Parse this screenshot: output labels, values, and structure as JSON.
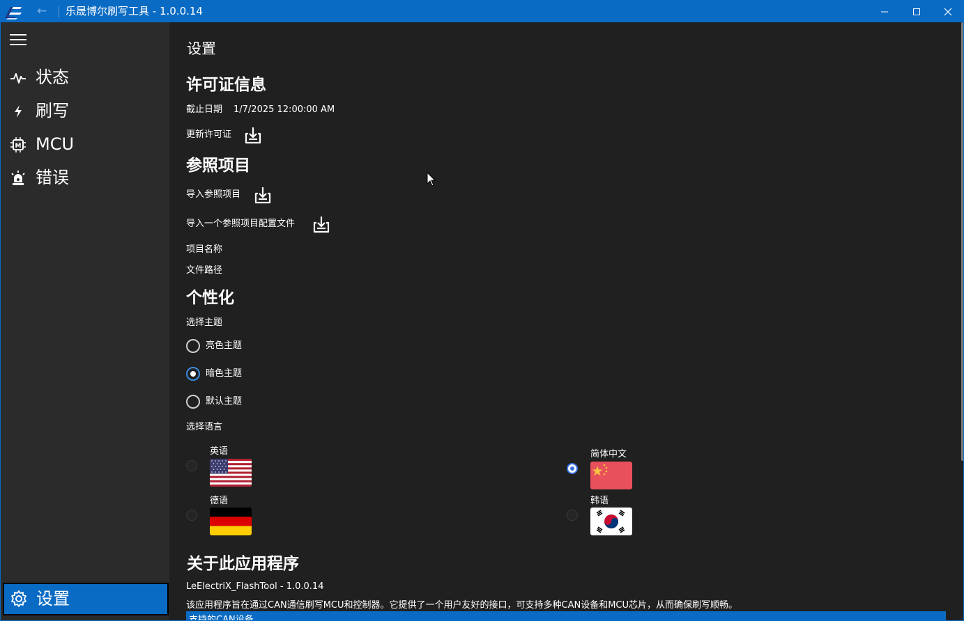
{
  "window": {
    "title": "乐晟博尔刷写工具 - 1.0.0.14",
    "accent_color": "#0a6bc4",
    "controls": [
      "minimize-icon",
      "maximize-icon",
      "close-icon"
    ]
  },
  "sidebar": {
    "items": [
      {
        "label": "状态",
        "icon": "activity-pulse-icon"
      },
      {
        "label": "刷写",
        "icon": "lightning-icon"
      },
      {
        "label": "MCU",
        "icon": "chip-icon"
      },
      {
        "label": "错误",
        "icon": "alarm-light-icon"
      }
    ],
    "settings_label": "设置",
    "settings_icon": "gear-icon"
  },
  "main": {
    "page_title": "设置",
    "license": {
      "heading": "许可证信息",
      "expiry_label": "截止日期",
      "expiry_value": "1/7/2025 12:00:00 AM",
      "update_label": "更新许可证"
    },
    "reference": {
      "heading": "参照项目",
      "import_project_label": "导入参照项目",
      "import_config_label": "导入一个参照项目配置文件",
      "project_name_label": "项目名称",
      "file_path_label": "文件路径"
    },
    "personalization": {
      "heading": "个性化",
      "theme_label": "选择主题",
      "themes": [
        {
          "label": "亮色主题",
          "selected": false
        },
        {
          "label": "暗色主题",
          "selected": true
        },
        {
          "label": "默认主题",
          "selected": false
        }
      ],
      "language_label": "选择语言",
      "languages": [
        {
          "label": "英语",
          "flag": "us-flag",
          "selected": false
        },
        {
          "label": "简体中文",
          "flag": "china-flag",
          "selected": true
        },
        {
          "label": "德语",
          "flag": "germany-flag",
          "selected": false
        },
        {
          "label": "韩语",
          "flag": "korea-flag",
          "selected": false
        }
      ]
    },
    "about": {
      "heading": "关于此应用程序",
      "version": "LeElectriX_FlashTool - 1.0.0.14",
      "description": "该应用程序旨在通过CAN通信刷写MCU和控制器。它提供了一个用户友好的接口，可支持多种CAN设备和MCU芯片，从而确保刷写顺畅。",
      "supported_devices_label": "支持的CAN设备"
    }
  }
}
